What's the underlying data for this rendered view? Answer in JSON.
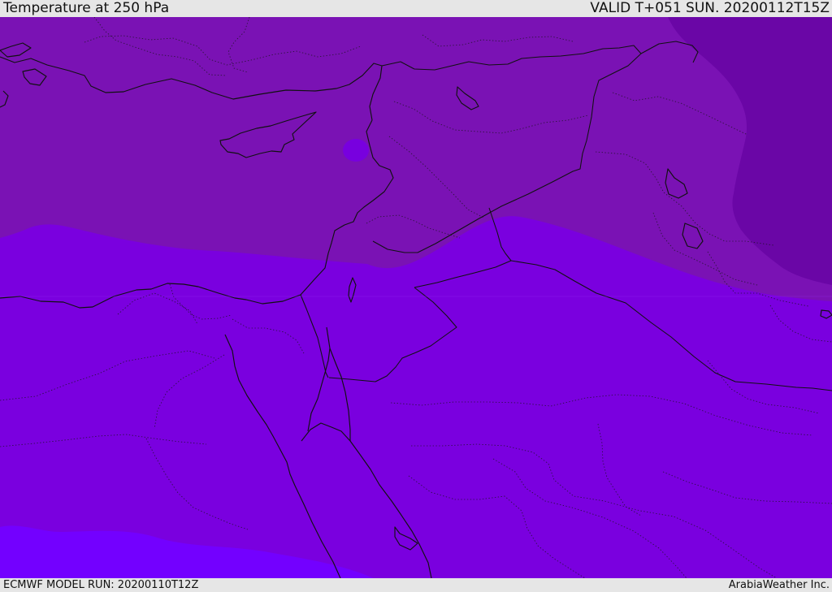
{
  "header": {
    "title": "Temperature at 250 hPa",
    "valid": "VALID T+051 SUN. 20200112T15Z"
  },
  "footer": {
    "model_run": "ECMWF MODEL RUN: 20200110T12Z",
    "credit": "ArabiaWeather Inc."
  },
  "colors": {
    "background": "#e6e6e6",
    "north_band": "#7a12b4",
    "northeast_band": "#6a06a6",
    "central_band": "#7a00df",
    "south_band": "#7300ff",
    "boundary": "#111111"
  }
}
